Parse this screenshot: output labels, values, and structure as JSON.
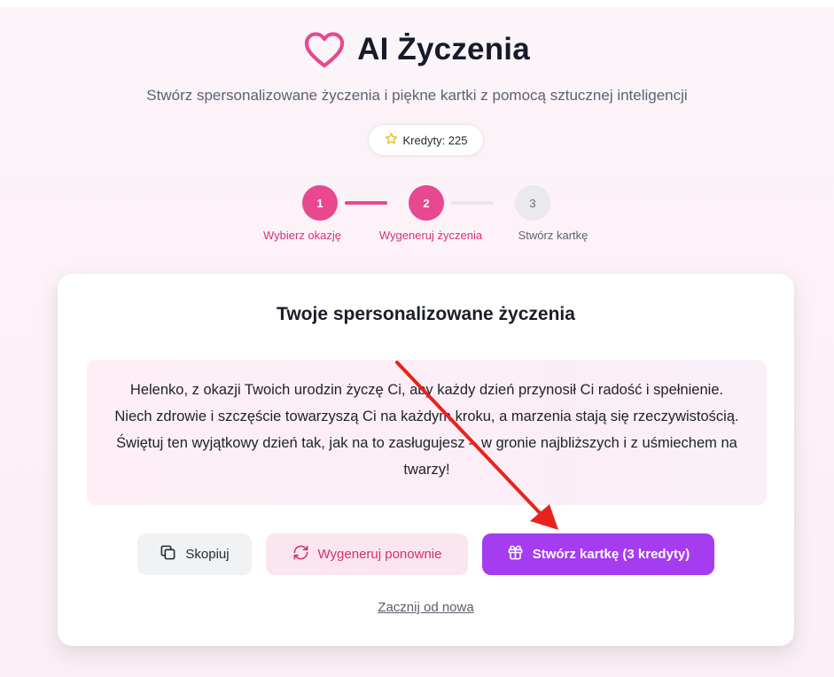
{
  "header": {
    "title": "AI Życzenia",
    "subtitle": "Stwórz spersonalizowane życzenia i piękne kartki z pomocą sztucznej inteligencji",
    "credits_label": "Kredyty: 225"
  },
  "steps": [
    {
      "number": "1",
      "label": "Wybierz okazję",
      "state": "done"
    },
    {
      "number": "2",
      "label": "Wygeneruj życzenia",
      "state": "active"
    },
    {
      "number": "3",
      "label": "Stwórz kartkę",
      "state": "pending"
    }
  ],
  "card": {
    "title": "Twoje spersonalizowane życzenia",
    "wish_text": "Helenko, z okazji Twoich urodzin życzę Ci, aby każdy dzień przynosił Ci radość i spełnienie. Niech zdrowie i szczęście towarzyszą Ci na każdym kroku, a marzenia stają się rzeczywistością. Świętuj ten wyjątkowy dzień tak, jak na to zasługujesz – w gronie najbliższych i z uśmiechem na twarzy!",
    "buttons": {
      "copy": "Skopiuj",
      "regenerate": "Wygeneruj ponownie",
      "create_card": "Stwórz kartkę (3 kredyty)"
    },
    "restart_link": "Zacznij od nowa"
  },
  "colors": {
    "accent_pink": "#e8488f",
    "accent_purple": "#a53cf0",
    "annotation_arrow": "#e8231d"
  },
  "icons": [
    "heart-icon",
    "star-icon",
    "copy-icon",
    "refresh-icon",
    "gift-icon"
  ]
}
